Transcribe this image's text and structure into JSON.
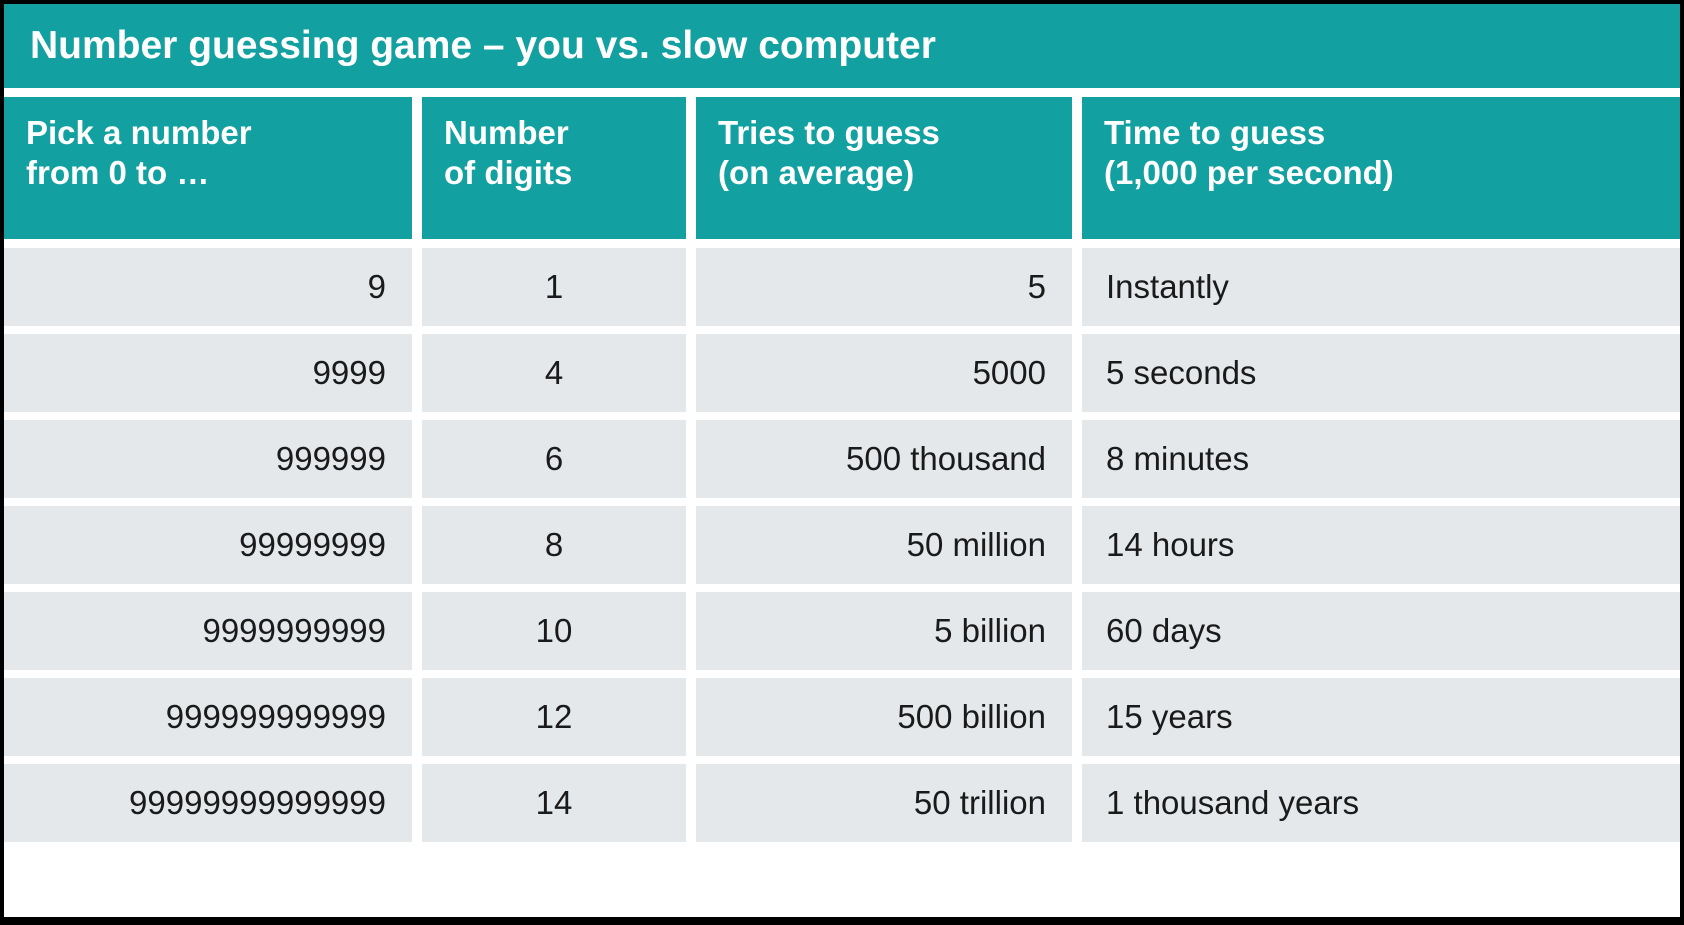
{
  "title": "Number guessing game – you vs. slow computer",
  "colors": {
    "header_teal": "#13a0a0",
    "row_background": "#e4e8eb",
    "header_text": "#ffffff",
    "body_text": "#1a1a1a",
    "frame": "#000000"
  },
  "table": {
    "columns": [
      {
        "line1": "Pick a number",
        "line2": "from 0 to …"
      },
      {
        "line1": "Number",
        "line2": "of digits"
      },
      {
        "line1": "Tries to guess",
        "line2": "(on average)"
      },
      {
        "line1": "Time to guess",
        "line2": "(1,000 per second)"
      }
    ],
    "rows": [
      {
        "max": "9",
        "digits": "1",
        "tries": "5",
        "time": "Instantly"
      },
      {
        "max": "9999",
        "digits": "4",
        "tries": "5000",
        "time": "5 seconds"
      },
      {
        "max": "999999",
        "digits": "6",
        "tries": "500 thousand",
        "time": "8 minutes"
      },
      {
        "max": "99999999",
        "digits": "8",
        "tries": "50 million",
        "time": "14 hours"
      },
      {
        "max": "9999999999",
        "digits": "10",
        "tries": "5 billion",
        "time": "60 days"
      },
      {
        "max": "999999999999",
        "digits": "12",
        "tries": "500 billion",
        "time": "15 years"
      },
      {
        "max": "99999999999999",
        "digits": "14",
        "tries": "50 trillion",
        "time": "1 thousand years"
      }
    ]
  }
}
